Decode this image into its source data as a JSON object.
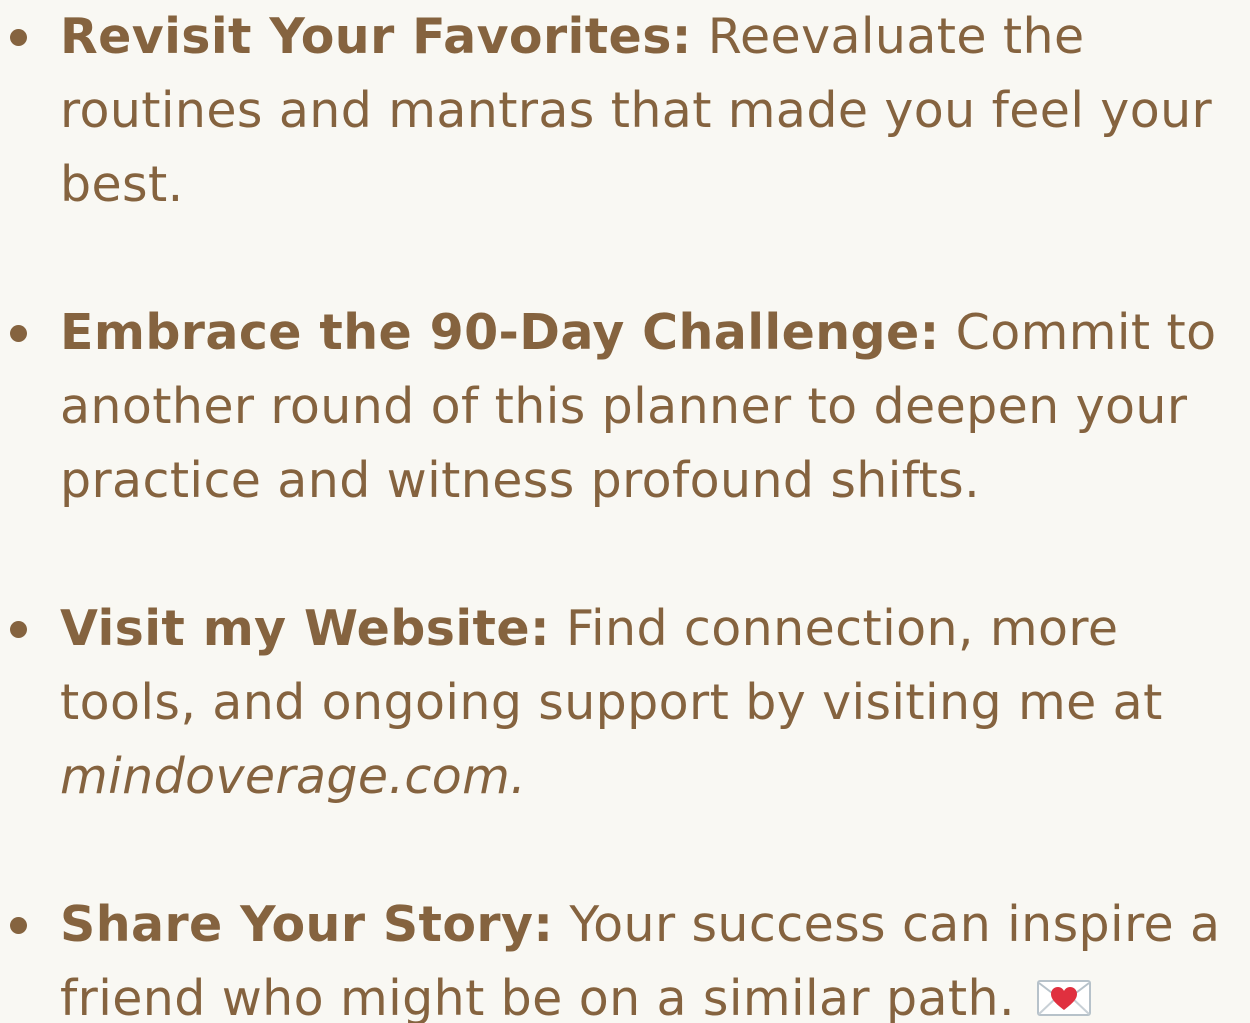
{
  "list": {
    "items": [
      {
        "heading": "Revisit Your Favorites:",
        "text": "Reevaluate the routines and mantras that made you feel your best."
      },
      {
        "heading": "Embrace the 90-Day Challenge:",
        "text": "Commit to another round of this planner to deepen your practice and witness profound shifts."
      },
      {
        "heading": "Visit my Website:",
        "text": "Find connection, more tools, and ongoing support by visiting me at",
        "website": "mindoverage.com.",
        "website_label": "mindoverage.com"
      },
      {
        "heading": "Share Your Story:",
        "text": "Your success can inspire a friend who might be on a similar path.",
        "icon": "love-letter-icon"
      }
    ]
  },
  "colors": {
    "text": "#85633f",
    "background": "#f9f8f3",
    "heart": "#e0303f"
  }
}
